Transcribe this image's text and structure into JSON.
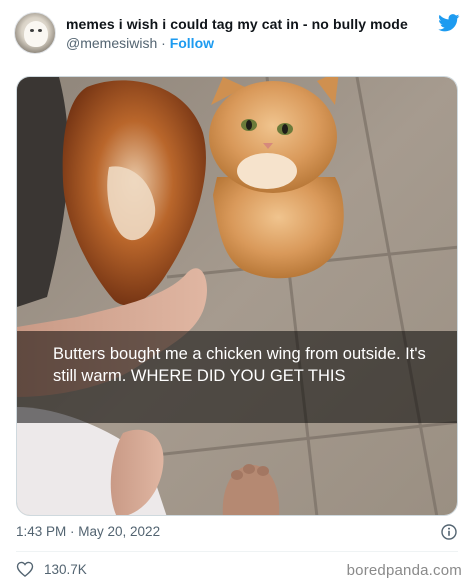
{
  "header": {
    "display_name": "memes i wish i could tag my cat in - no bully mode",
    "handle": "@memesiwish",
    "separator": "·",
    "follow_label": "Follow",
    "platform_icon": "twitter-bird-icon"
  },
  "media": {
    "caption": "Butters bought me a chicken wing from outside. It's still warm. WHERE DID YOU GET THIS"
  },
  "meta": {
    "timestamp": "1:43 PM · May 20, 2022",
    "info_icon": "info-icon"
  },
  "engagement": {
    "like_icon": "heart-icon",
    "like_count": "130.7K"
  },
  "watermark": "boredpanda.com",
  "colors": {
    "accent": "#1d9bf0",
    "secondary_text": "#536471",
    "primary_text": "#0f1419",
    "divider": "#eff3f4"
  }
}
